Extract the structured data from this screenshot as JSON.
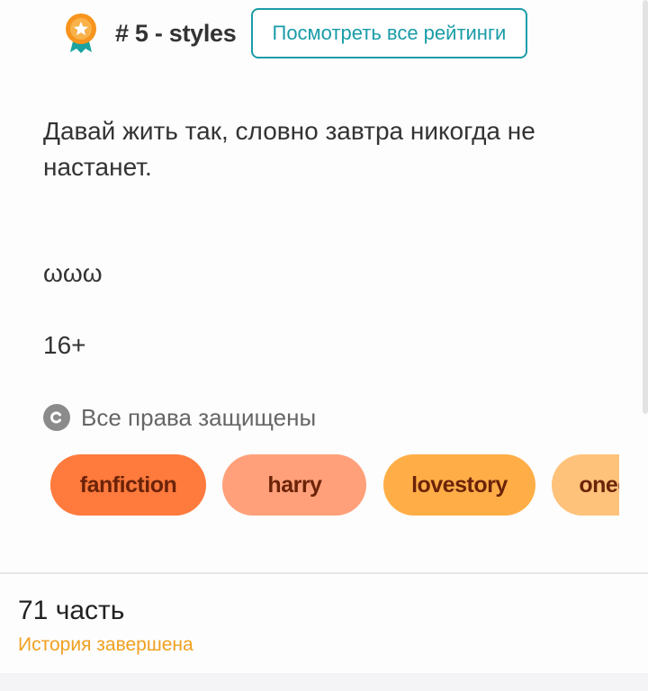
{
  "ranking": {
    "medal_icon": "medal-star-icon",
    "rank_label": "# 5 - styles",
    "view_all_button": "Посмотреть все рейтинги"
  },
  "description": "Давай жить так, словно завтра никогда не настанет.",
  "extra_line": "ωωω",
  "age_rating": "16+",
  "copyright": {
    "icon": "copyright-icon",
    "label": "Все права защищены"
  },
  "tags": [
    "fanfiction",
    "harry",
    "lovestory",
    "onedirection"
  ],
  "story_info": {
    "parts": "71 часть",
    "status": "История завершена"
  },
  "colors": {
    "accent": "#1a9ca8",
    "status": "#f0a020",
    "tag_1": "#ff7a3d",
    "tag_2": "#ffa07a",
    "tag_3": "#ffae47",
    "tag_4": "#ffc27a"
  }
}
